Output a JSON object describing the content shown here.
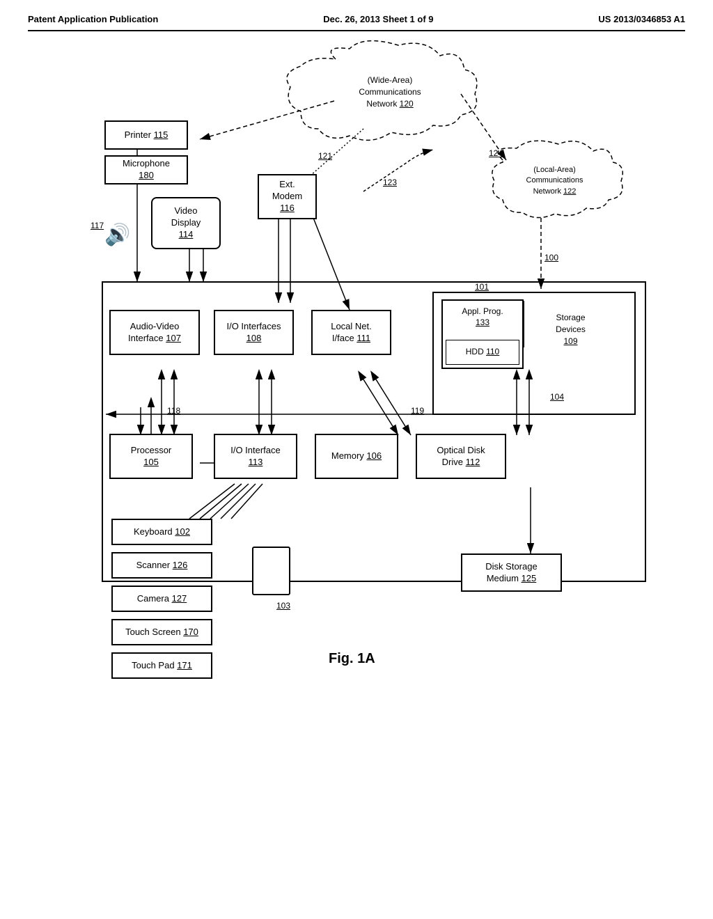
{
  "header": {
    "left": "Patent Application Publication",
    "center": "Dec. 26, 2013   Sheet 1 of 9",
    "right": "US 2013/0346853 A1"
  },
  "diagram": {
    "fig_label": "Fig. 1A",
    "nodes": {
      "printer": {
        "label": "Printer",
        "ref": "115"
      },
      "microphone": {
        "label": "Microphone",
        "ref": "180"
      },
      "video_display": {
        "label": "Video\nDisplay",
        "ref": "114"
      },
      "ext_modem": {
        "label": "Ext.\nModem",
        "ref": "116"
      },
      "speaker": {
        "ref": "117"
      },
      "wan": {
        "label": "(Wide-Area)\nCommunications\nNetwork",
        "ref": "120"
      },
      "lan": {
        "label": "(Local-Area)\nCommunications\nNetwork",
        "ref": "122"
      },
      "ref_124": {
        "ref": "124"
      },
      "ref_121": {
        "ref": "121"
      },
      "ref_123": {
        "ref": "123"
      },
      "ref_100": {
        "ref": "100"
      },
      "ref_101": {
        "ref": "101"
      },
      "computer_box": {
        "ref": "101"
      },
      "audio_video": {
        "label": "Audio-Video\nInterface",
        "ref": "107"
      },
      "io_interfaces": {
        "label": "I/O Interfaces",
        "ref": "108"
      },
      "local_net": {
        "label": "Local Net.\nI/face",
        "ref": "111"
      },
      "appl_prog": {
        "label": "Appl. Prog.",
        "ref": "133"
      },
      "hdd": {
        "label": "HDD",
        "ref": "110"
      },
      "storage_devices": {
        "label": "Storage\nDevices",
        "ref": "109"
      },
      "ref_104": {
        "ref": "104"
      },
      "ref_118": {
        "ref": "118"
      },
      "ref_119": {
        "ref": "119"
      },
      "processor": {
        "label": "Processor",
        "ref": "105"
      },
      "io_interface": {
        "label": "I/O Interface",
        "ref": "113"
      },
      "memory": {
        "label": "Memory",
        "ref": "106"
      },
      "optical_disk": {
        "label": "Optical Disk\nDrive",
        "ref": "112"
      },
      "keyboard": {
        "label": "Keyboard",
        "ref": "102"
      },
      "scanner": {
        "label": "Scanner",
        "ref": "126"
      },
      "camera": {
        "label": "Camera",
        "ref": "127"
      },
      "touch_screen": {
        "label": "Touch Screen",
        "ref": "170"
      },
      "touch_pad": {
        "label": "Touch Pad",
        "ref": "171"
      },
      "ref_103": {
        "ref": "103"
      },
      "disk_storage": {
        "label": "Disk Storage\nMedium",
        "ref": "125"
      }
    }
  }
}
